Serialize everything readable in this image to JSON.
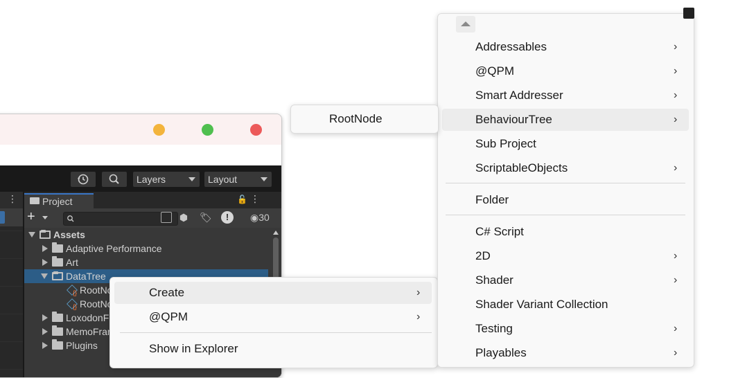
{
  "unity": {
    "toolbar": {
      "layers_label": "Layers",
      "layout_label": "Layout"
    },
    "project": {
      "tab_label": "Project",
      "hidden_count": "30",
      "tree": [
        {
          "label": "Assets",
          "depth": 0,
          "expanded": true,
          "kind": "folder"
        },
        {
          "label": "Adaptive Performance",
          "depth": 1,
          "expanded": false,
          "kind": "folder"
        },
        {
          "label": "Art",
          "depth": 1,
          "expanded": false,
          "kind": "folder"
        },
        {
          "label": "DataTree",
          "depth": 1,
          "expanded": true,
          "kind": "folder",
          "selected": true
        },
        {
          "label": "RootNo",
          "depth": 2,
          "kind": "asset"
        },
        {
          "label": "RootNo",
          "depth": 2,
          "kind": "asset"
        },
        {
          "label": "LoxodonF",
          "depth": 1,
          "expanded": false,
          "kind": "folder"
        },
        {
          "label": "MemoFrar",
          "depth": 1,
          "expanded": false,
          "kind": "folder"
        },
        {
          "label": "Plugins",
          "depth": 1,
          "expanded": false,
          "kind": "folder"
        }
      ]
    }
  },
  "context_menu": {
    "items": [
      {
        "label": "Create",
        "submenu": true
      },
      {
        "label": "@QPM",
        "submenu": true
      },
      {
        "label": "Show in Explorer",
        "submenu": false
      }
    ]
  },
  "create_menu": {
    "items": [
      {
        "label": "Addressables",
        "submenu": true
      },
      {
        "label": "@QPM",
        "submenu": true
      },
      {
        "label": "Smart Addresser",
        "submenu": true
      },
      {
        "label": "BehaviourTree",
        "submenu": true
      },
      {
        "label": "Sub Project",
        "submenu": false
      },
      {
        "label": "ScriptableObjects",
        "submenu": true
      },
      {
        "label": "Folder",
        "submenu": false
      },
      {
        "label": "C# Script",
        "submenu": false
      },
      {
        "label": "2D",
        "submenu": true
      },
      {
        "label": "Shader",
        "submenu": true
      },
      {
        "label": "Shader Variant Collection",
        "submenu": false
      },
      {
        "label": "Testing",
        "submenu": true
      },
      {
        "label": "Playables",
        "submenu": true
      }
    ]
  },
  "behaviourtree_menu": {
    "items": [
      {
        "label": "RootNode",
        "submenu": false
      }
    ]
  },
  "icons": {
    "chevron": "›",
    "kebab": "⋮",
    "plus": "+",
    "warning": "!",
    "eye": "👁"
  }
}
